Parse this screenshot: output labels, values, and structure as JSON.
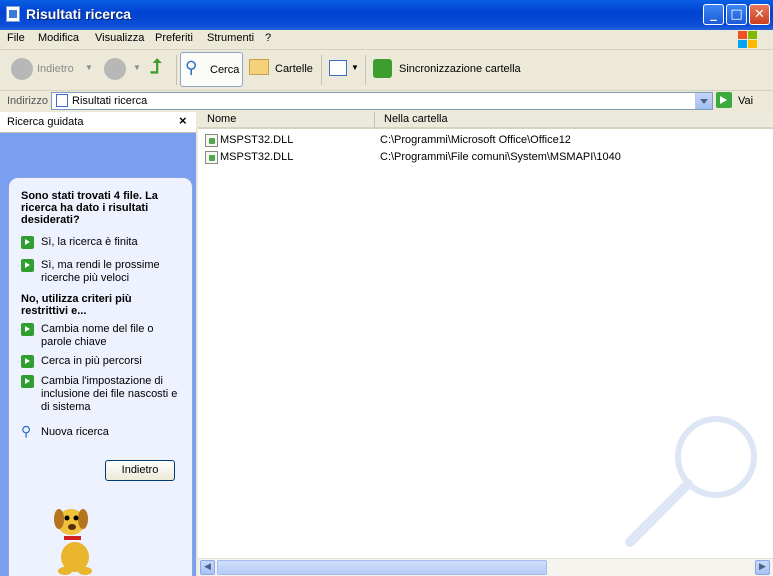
{
  "window": {
    "title": "Risultati ricerca"
  },
  "menu": [
    "File",
    "Modifica",
    "Visualizza",
    "Preferiti",
    "Strumenti",
    "?"
  ],
  "toolbar": {
    "back_label": "Indietro",
    "search_label": "Cerca",
    "folders_label": "Cartelle",
    "sync_label": "Sincronizzazione cartella"
  },
  "address": {
    "label": "Indirizzo",
    "value": "Risultati ricerca",
    "go_label": "Vai"
  },
  "left_pane": {
    "title": "Ricerca guidata",
    "message": "Sono stati trovati 4 file. La ricerca ha dato i risultati desiderati?",
    "options_yes": [
      "Sì, la ricerca è finita",
      "Sì, ma rendi le prossime ricerche più veloci"
    ],
    "no_heading": "No, utilizza criteri più restrittivi e...",
    "options_no": [
      "Cambia nome del file o parole chiave",
      "Cerca in più percorsi",
      "Cambia l'impostazione di inclusione dei file nascosti e di sistema"
    ],
    "new_search": "Nuova ricerca",
    "back_button": "Indietro"
  },
  "list": {
    "columns": [
      "Nome",
      "Nella cartella"
    ],
    "rows": [
      {
        "name": "MSPST32.DLL",
        "folder": "C:\\Programmi\\Microsoft Office\\Office12"
      },
      {
        "name": "MSPST32.DLL",
        "folder": "C:\\Programmi\\File comuni\\System\\MSMAPI\\1040"
      }
    ]
  },
  "colors": {
    "title_blue": "#0042d2",
    "pane_blue": "#7a9ef0",
    "go_green": "#3ca93c"
  }
}
